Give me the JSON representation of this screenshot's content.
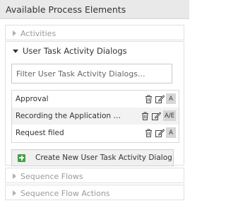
{
  "panel": {
    "title": "Available Process Elements"
  },
  "sections": {
    "activities": {
      "label": "Activities"
    },
    "user_task_dialogs": {
      "label": "User Task Activity Dialogs",
      "filter_placeholder": "Filter User Task Activity Dialogs...",
      "items": [
        {
          "name": "Approval",
          "badge": "A"
        },
        {
          "name": "Recording the Application f...",
          "badge": "A/E"
        },
        {
          "name": "Request filed",
          "badge": "A"
        }
      ],
      "create_label": "Create New User Task Activity Dialog"
    },
    "sequence_flows": {
      "label": "Sequence Flows"
    },
    "sequence_flow_actions": {
      "label": "Sequence Flow Actions"
    }
  },
  "icons": {
    "collapsed": "triangle-right-icon",
    "expanded": "triangle-down-icon",
    "delete": "trash-icon",
    "edit": "edit-icon",
    "create": "plus-icon"
  },
  "colors": {
    "header_bg": "#e9e9e9",
    "create_icon": "#43a047",
    "badge_bg": "#d6d6d6"
  }
}
